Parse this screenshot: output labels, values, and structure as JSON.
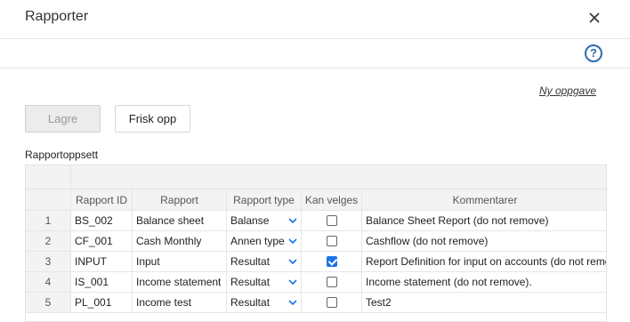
{
  "dialog": {
    "title": "Rapporter",
    "new_task_link": "Ny oppgave"
  },
  "toolbar": {
    "save_label": "Lagre",
    "refresh_label": "Frisk opp"
  },
  "section": {
    "label": "Rapportoppsett"
  },
  "table": {
    "columns": [
      "Rapport ID",
      "Rapport",
      "Rapport type",
      "Kan velges",
      "Kommentarer"
    ],
    "rows": [
      {
        "num": "1",
        "id": "BS_002",
        "name": "Balance sheet",
        "type": "Balanse",
        "selectable": false,
        "comment": "Balance Sheet Report (do not remove)"
      },
      {
        "num": "2",
        "id": "CF_001",
        "name": "Cash Monthly",
        "type": "Annen type",
        "selectable": false,
        "comment": "Cashflow (do not remove)"
      },
      {
        "num": "3",
        "id": "INPUT",
        "name": "Input",
        "type": "Resultat",
        "selectable": true,
        "comment": "Report Definition for input on accounts (do not remove)"
      },
      {
        "num": "4",
        "id": "IS_001",
        "name": "Income statement",
        "type": "Resultat",
        "selectable": false,
        "comment": "Income statement (do not remove)."
      },
      {
        "num": "5",
        "id": "PL_001",
        "name": "Income test",
        "type": "Resultat",
        "selectable": false,
        "comment": "Test2"
      }
    ]
  },
  "icons": {
    "close": "close-icon",
    "help": "help-icon",
    "dropdown": "chevron-down-icon"
  },
  "colors": {
    "accent": "#1a73e8",
    "help": "#2b6cb0"
  }
}
